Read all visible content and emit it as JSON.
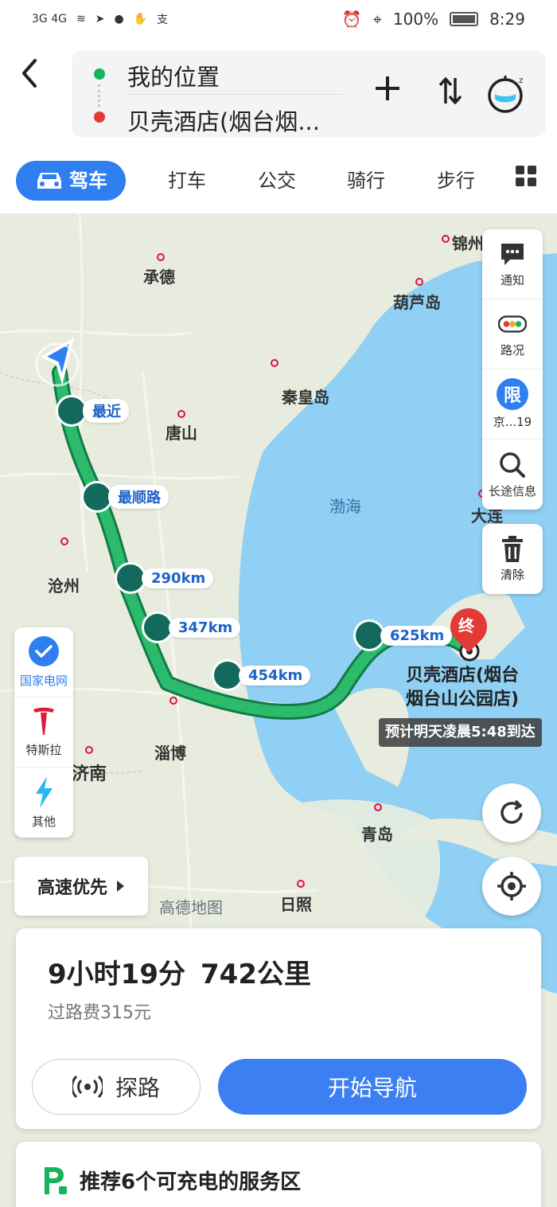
{
  "status_bar": {
    "network_left": "3G 4G",
    "alipay": "支",
    "battery": "100%",
    "time": "8:29"
  },
  "route": {
    "origin": "我的位置",
    "destination": "贝壳酒店(烟台烟..."
  },
  "tabs": [
    {
      "label": "驾车",
      "active": true
    },
    {
      "label": "打车"
    },
    {
      "label": "公交"
    },
    {
      "label": "骑行"
    },
    {
      "label": "步行"
    }
  ],
  "map": {
    "cities": [
      "承德",
      "唐山",
      "秦皇岛",
      "葫芦岛",
      "锦州",
      "沧州",
      "淄博",
      "济南",
      "青岛",
      "日照",
      "大连"
    ],
    "sea": "渤海",
    "chargers": [
      "最近",
      "最顺路",
      "290km",
      "347km",
      "454km",
      "625km"
    ],
    "end_marker": "终",
    "destination_label_1": "贝壳酒店(烟台",
    "destination_label_2": "烟台山公园店)",
    "eta": "预计明天凌晨5:48到达",
    "watermark": "高德地图"
  },
  "right_panel": {
    "notify": "通知",
    "traffic": "路况",
    "limit_badge": "限",
    "limit": "京...19",
    "long_info": "长途信息",
    "clear": "清除"
  },
  "left_panel": {
    "state_grid": "国家电网",
    "tesla": "特斯拉",
    "other": "其他"
  },
  "preference": "高速优先",
  "summary": {
    "time": "9小时19分",
    "distance": "742公里",
    "toll": "过路费315元",
    "explore": "探路",
    "start_nav": "开始导航"
  },
  "recommend": {
    "text": "推荐6个可充电的服务区"
  },
  "colors": {
    "accent": "#2f7ff0",
    "route": "#1aa35a",
    "charger": "#136a5c",
    "end": "#e53935"
  }
}
